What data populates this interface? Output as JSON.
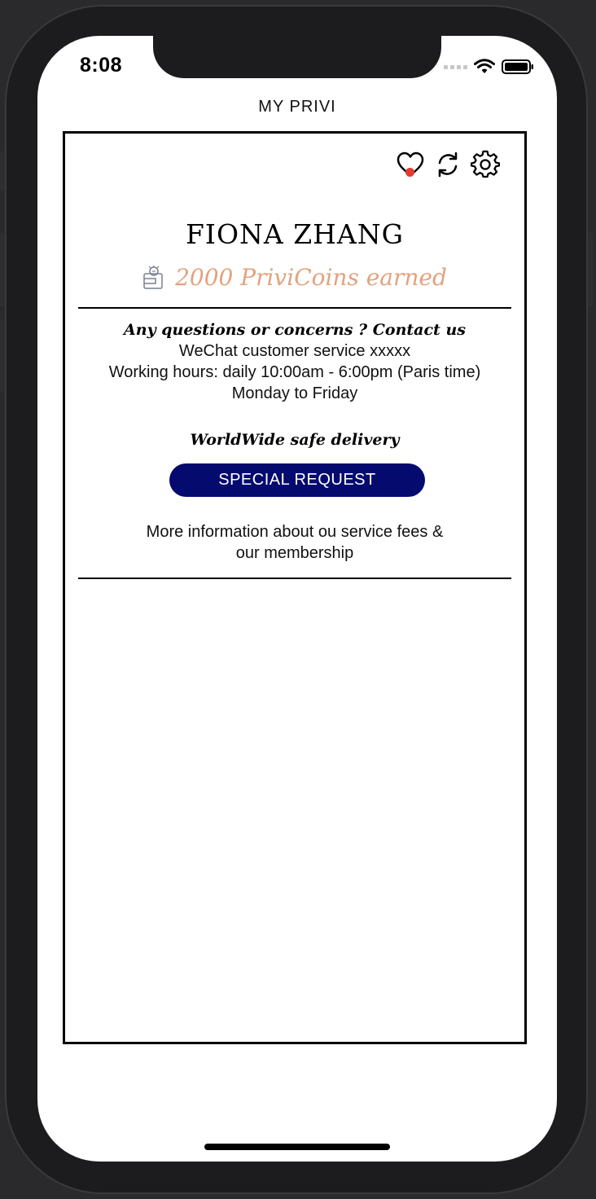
{
  "status_bar": {
    "time": "8:08"
  },
  "nav": {
    "title": "MY PRIVI"
  },
  "card": {
    "icons": [
      "heart-icon",
      "refresh-icon",
      "gear-icon"
    ],
    "user_name": "FIONA ZHANG",
    "coins_text": "2000 PriviCoins earned",
    "contact_heading": "Any questions or concerns ? Contact us",
    "wechat_line": "WeChat customer service xxxxx",
    "hours_line": "Working hours: daily 10:00am - 6:00pm (Paris time)",
    "days_line": "Monday to Friday",
    "delivery_text": "WorldWide safe delivery",
    "special_request_label": "SPECIAL REQUEST",
    "more_info_line1": "More information about ou service fees &",
    "more_info_line2": "our membership"
  },
  "colors": {
    "accent_button": "#050a6e",
    "coins_text": "#e3a27e",
    "notification_dot": "#e33b2e"
  }
}
